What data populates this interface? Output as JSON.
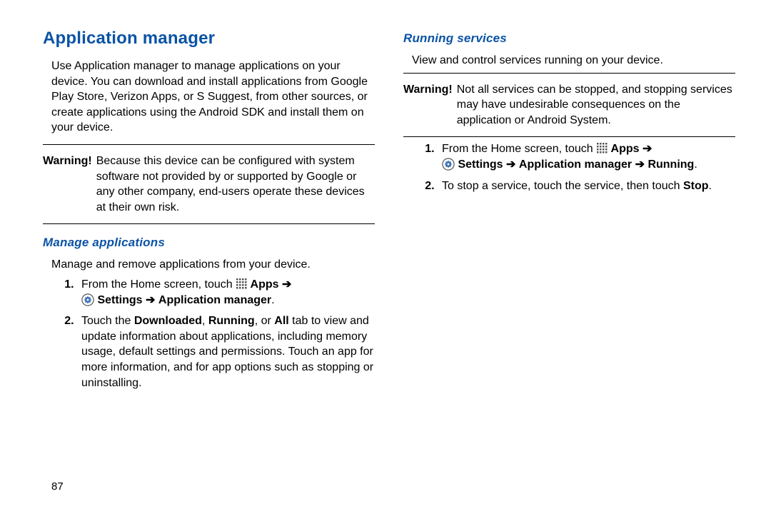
{
  "page_number": "87",
  "left": {
    "heading": "Application manager",
    "intro": "Use Application manager to manage applications on your device. You can download and install applications from Google Play Store, Verizon Apps, or S Suggest, from other sources, or create applications using the Android SDK and install them on your device.",
    "warning_label": "Warning!",
    "warning_body": "Because this device can be configured with system software not provided by or supported by Google or any other company, end-users operate these devices at their own risk.",
    "subheading": "Manage applications",
    "subintro": "Manage and remove applications from your device.",
    "step1_prefix": "From the Home screen, touch ",
    "step1_apps": "Apps",
    "step1_settings": "Settings",
    "step1_appmgr": "Application manager",
    "step2_a": "Touch the ",
    "step2_downloaded": "Downloaded",
    "step2_b": ", ",
    "step2_running": "Running",
    "step2_c": ", or ",
    "step2_all": "All",
    "step2_d": " tab to view and update information about applications, including memory usage, default settings and permissions. Touch an app for more information, and for app options such as stopping or uninstalling."
  },
  "right": {
    "subheading": "Running services",
    "subintro": "View and control services running on your device.",
    "warning_label": "Warning!",
    "warning_body": "Not all services can be stopped, and stopping services may have undesirable consequences on the application or Android System.",
    "step1_prefix": "From the Home screen, touch ",
    "step1_apps": "Apps",
    "step1_settings": "Settings",
    "step1_appmgr": "Application manager",
    "step1_running": "Running",
    "step2_a": "To stop a service, touch the service, then touch ",
    "step2_stop": "Stop",
    "step2_b": "."
  },
  "glyphs": {
    "arrow": "➔"
  }
}
